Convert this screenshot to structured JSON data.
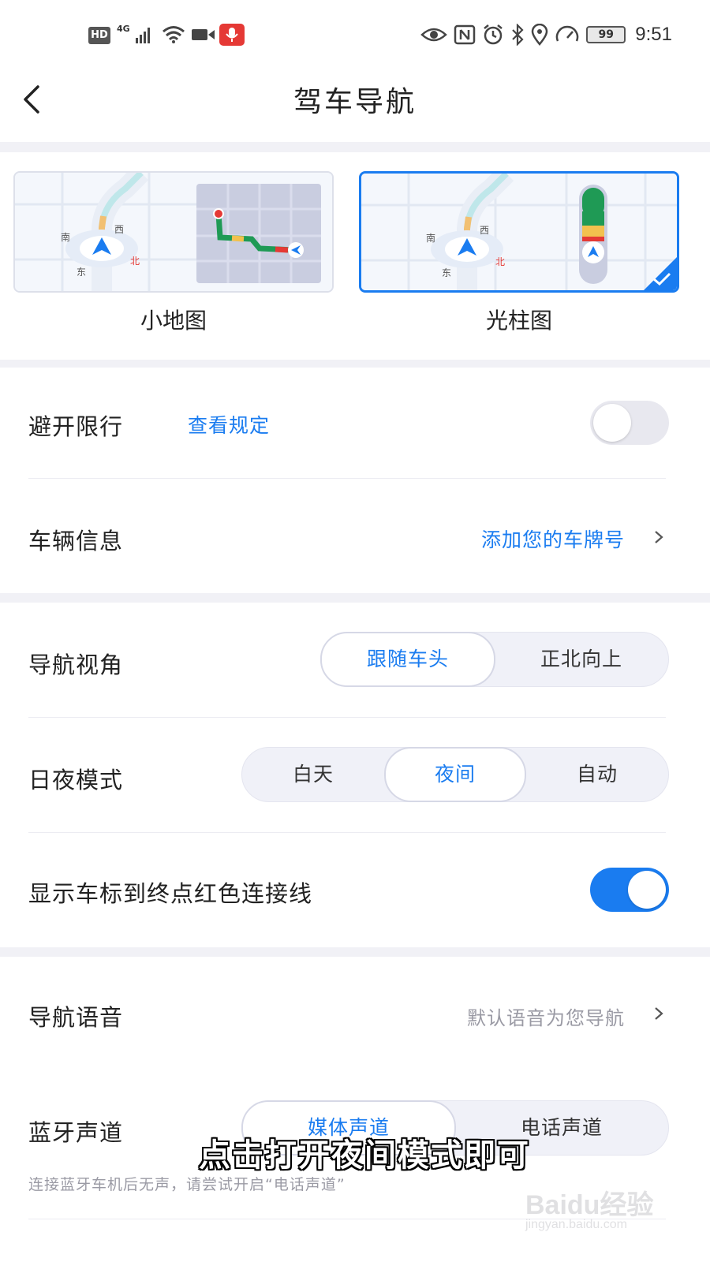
{
  "status_bar": {
    "hd": "HD",
    "network": "4G",
    "battery": "99",
    "time": "9:51"
  },
  "header": {
    "title": "驾车导航"
  },
  "map_style": {
    "options": [
      {
        "label": "小地图",
        "selected": false
      },
      {
        "label": "光柱图",
        "selected": true
      }
    ],
    "map_labels": {
      "south": "南",
      "west": "西",
      "east": "东",
      "north": "北"
    }
  },
  "settings": {
    "avoid_restriction": {
      "label": "避开限行",
      "link": "查看规定",
      "enabled": false
    },
    "vehicle_info": {
      "label": "车辆信息",
      "value": "添加您的车牌号"
    },
    "nav_view": {
      "label": "导航视角",
      "options": [
        "跟随车头",
        "正北向上"
      ],
      "selected": "跟随车头"
    },
    "day_night": {
      "label": "日夜模式",
      "options": [
        "白天",
        "夜间",
        "自动"
      ],
      "selected": "夜间"
    },
    "red_line": {
      "label": "显示车标到终点红色连接线",
      "enabled": true
    },
    "nav_voice": {
      "label": "导航语音",
      "value": "默认语音为您导航"
    },
    "bt_channel": {
      "label": "蓝牙声道",
      "options": [
        "媒体声道",
        "电话声道"
      ],
      "selected": "媒体声道",
      "hint": "连接蓝牙车机后无声，请尝试开启“电话声道”"
    }
  },
  "overlay": {
    "caption": "点击打开夜间模式即可",
    "watermark_main": "Baidu经验",
    "watermark_sub": "jingyan.baidu.com"
  },
  "colors": {
    "accent": "#1a7cf0",
    "section_bg": "#f1f1f6",
    "muted_text": "#9a9aa4"
  }
}
